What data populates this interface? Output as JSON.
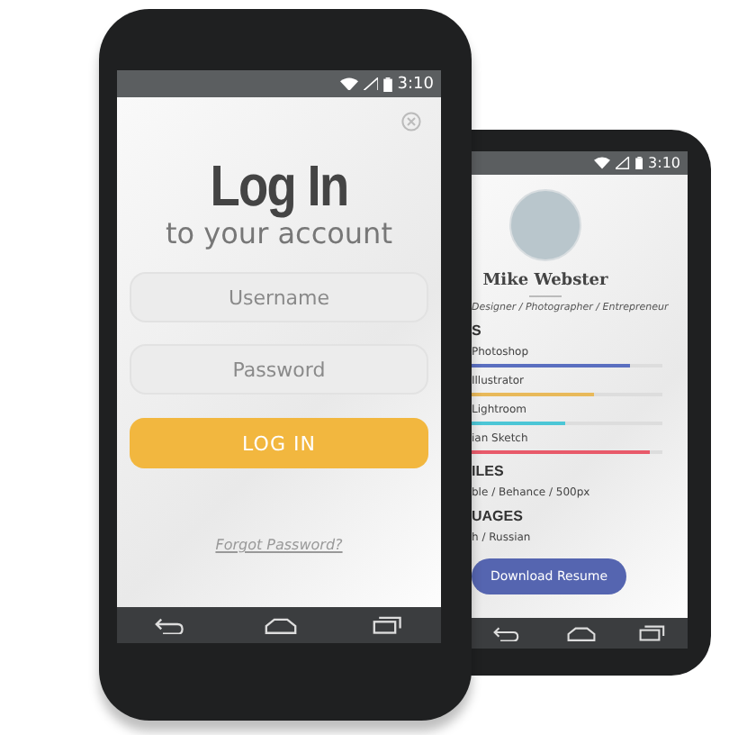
{
  "login_phone": {
    "status_bar": {
      "time": "3:10"
    },
    "title": "Log In",
    "subtitle": "to your account",
    "fields": [
      {
        "placeholder": "Username"
      },
      {
        "placeholder": "Password"
      }
    ],
    "login_button": "LOG IN",
    "forgot_link": "Forgot Password?"
  },
  "profile_phone": {
    "status_bar": {
      "time": "3:10"
    },
    "name": "Mike Webster",
    "tagline": "Designer / Photographer / Entrepreneur",
    "skills_heading": "S",
    "skills": [
      {
        "name": "Photoshop",
        "level": 0.83,
        "color": "#5a6fc0"
      },
      {
        "name": "Illustrator",
        "level": 0.64,
        "color": "#e8b95a"
      },
      {
        "name": "Lightroom",
        "level": 0.49,
        "color": "#4cc6d6"
      },
      {
        "name": "ian Sketch",
        "level": 0.93,
        "color": "#e85a6a"
      }
    ],
    "profiles_heading": "ILES",
    "profiles": "ble / Behance / 500px",
    "languages_heading": "UAGES",
    "languages": "h / Russian",
    "download_button": "Download Resume"
  }
}
